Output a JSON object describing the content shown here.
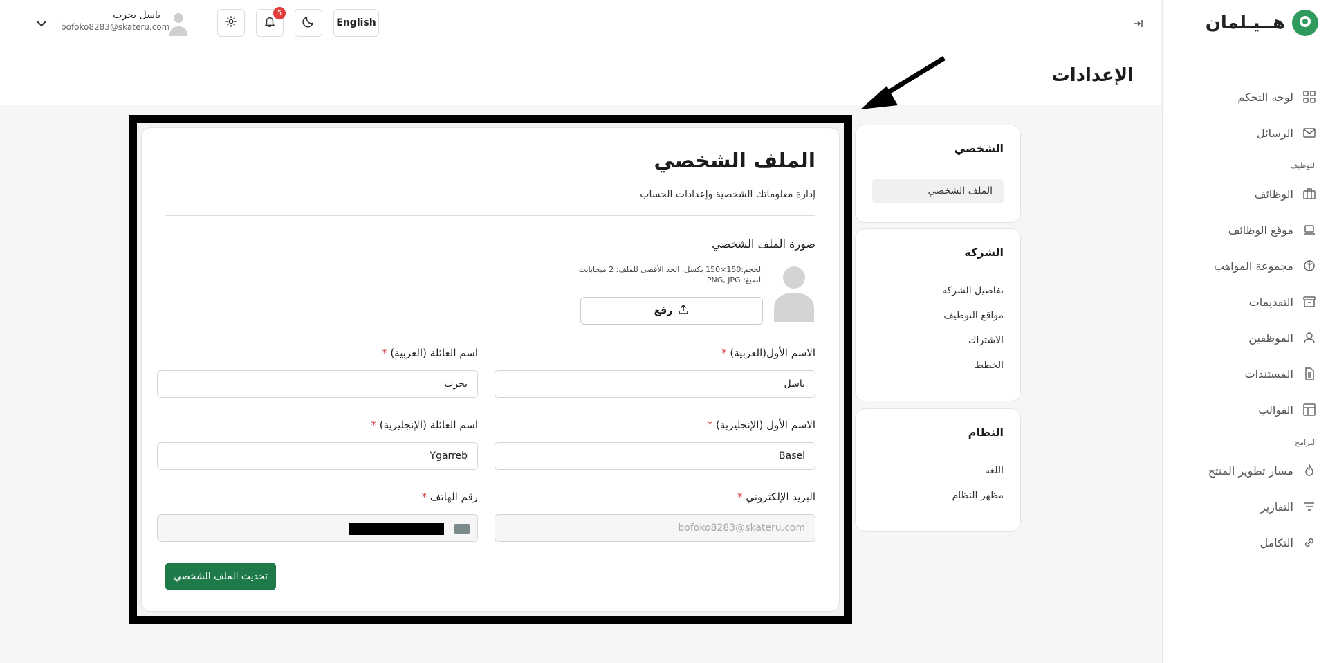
{
  "brand": {
    "name": "هــيـلمان"
  },
  "sidebar": {
    "items": [
      {
        "label": "لوحة التحكم",
        "icon": "grid-icon"
      },
      {
        "label": "الرسائل",
        "icon": "mail-icon"
      }
    ],
    "section_hiring": "التوظيف",
    "hiring_items": [
      {
        "label": "الوظائف",
        "icon": "briefcase-icon"
      },
      {
        "label": "موقع الوظائف",
        "icon": "laptop-icon"
      },
      {
        "label": "مجموعة المواهب",
        "icon": "brain-icon"
      },
      {
        "label": "التقديمات",
        "icon": "archive-icon"
      },
      {
        "label": "الموظفين",
        "icon": "user-icon"
      },
      {
        "label": "المستندات",
        "icon": "document-icon"
      },
      {
        "label": "القوالب",
        "icon": "layout-icon"
      }
    ],
    "section_programs": "البرامج",
    "program_items": [
      {
        "label": "مسار تطوير المنتج",
        "icon": "flame-icon"
      },
      {
        "label": "التقارير",
        "icon": "filter-icon"
      },
      {
        "label": "التكامل",
        "icon": "link-icon"
      }
    ]
  },
  "topbar": {
    "user_name": "باسل يجرب",
    "user_email": "bofoko8283@skateru.com",
    "notifications_count": "5",
    "language_label": "English"
  },
  "page": {
    "title": "الإعدادات"
  },
  "settings_nav": {
    "personal": {
      "title": "الشخصي",
      "links": [
        "الملف الشخصي"
      ]
    },
    "company": {
      "title": "الشركة",
      "links": [
        "تفاصيل الشركة",
        "مواقع التوظيف",
        "الاشتراك",
        "الخطط"
      ]
    },
    "system": {
      "title": "النظام",
      "links": [
        "اللغة",
        "مظهر النظام"
      ]
    }
  },
  "profile": {
    "title": "الملف الشخصي",
    "subtitle": "إدارة معلوماتك الشخصية وإعدادات الحساب",
    "photo_label": "صورة الملف الشخصي",
    "photo_hint_size": "الحجم:150×150 بكسل، الحد الأقصى للملف: 2 ميجابايت",
    "photo_hint_formats": "الصيغ: PNG, JPG",
    "upload_label": "رفع",
    "first_name_ar_label": "الاسم الأول(العربية)",
    "first_name_ar_value": "باسل",
    "last_name_ar_label": "اسم العائلة (العربية)",
    "last_name_ar_value": "يجرب",
    "first_name_en_label": "الاسم الأول (الإنجليزية)",
    "first_name_en_value": "Basel",
    "last_name_en_label": "اسم العائلة (الإنجليزية)",
    "last_name_en_value": "Ygarreb",
    "email_label": "البريد الإلكتروني",
    "email_value": "bofoko8283@skateru.com",
    "phone_label": "رقم الهاتف",
    "required_mark": "*",
    "submit_label": "تحديث الملف الشخصي"
  },
  "colors": {
    "accent": "#1f7a4a",
    "brand": "#2e9a5c",
    "badge": "#e23b3b"
  }
}
